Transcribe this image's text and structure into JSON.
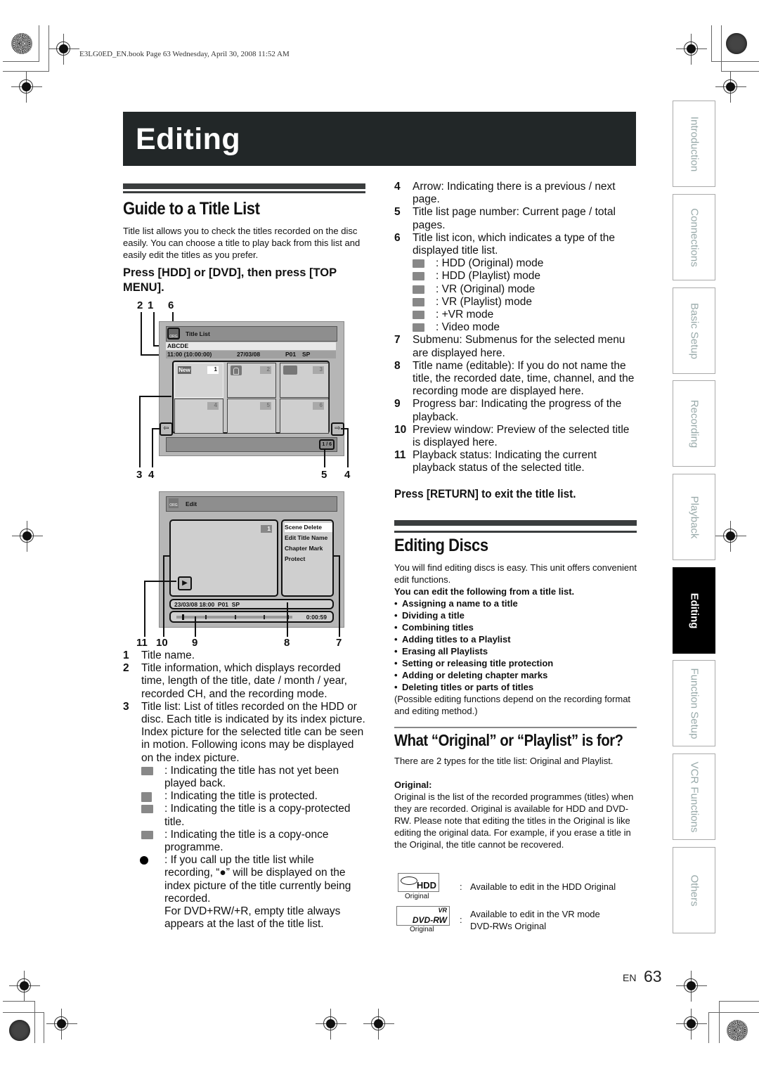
{
  "print_header": "E3LG0ED_EN.book  Page 63  Wednesday, April 30, 2008  11:52 AM",
  "banner_title": "Editing",
  "guide": {
    "heading": "Guide to a Title List",
    "intro": "Title list allows you to check the titles recorded on the disc easily. You can choose a title to play back from this list and easily edit the titles as you prefer.",
    "step": "Press [HDD] or [DVD], then press [TOP MENU]."
  },
  "title_list_screen": {
    "callouts_top": [
      "2",
      "1",
      "6"
    ],
    "icon_label": "ORG",
    "title": "Title List",
    "selected_name": "ABCDE",
    "info_time": "11:00 (10:00:00)",
    "info_date": "27/03/08",
    "info_ch": "P01",
    "info_mode": "SP",
    "new_badge": "New",
    "cells": [
      "1",
      "2",
      "3",
      "4",
      "5",
      "6"
    ],
    "page": "1 / 6",
    "callouts_bottom": [
      "3",
      "4",
      "5",
      "4"
    ]
  },
  "edit_screen": {
    "icon_label": "ORG",
    "title": "Edit",
    "preview_number": "1",
    "submenu": [
      "Scene Delete",
      "Edit Title Name",
      "Chapter Mark",
      "Protect"
    ],
    "title_info": "23/03/08 18:00  P01  SP",
    "time": "0:00:59",
    "progress_fraction": 0.05,
    "callouts_bottom": [
      "11",
      "10",
      "9",
      "8",
      "7"
    ]
  },
  "descriptions_left": [
    {
      "num": "1",
      "text": "Title name."
    },
    {
      "num": "2",
      "text": "Title information, which displays recorded time, length of the title, date / month / year, recorded CH, and the recording mode."
    },
    {
      "num": "3",
      "text": "Title list: List of titles recorded on the HDD or disc. Each title is indicated by its index picture. Index picture for the selected title can be seen in motion. Following icons may be displayed on the index picture."
    }
  ],
  "index_icons": [
    {
      "icon": "new-icon",
      "text": ": Indicating the title has not yet been played back."
    },
    {
      "icon": "protect-lock-icon",
      "text": ": Indicating the title is protected."
    },
    {
      "icon": "copy-protected-icon",
      "text": ": Indicating the title is a copy-protected title."
    },
    {
      "icon": "copy-once-icon",
      "text": ": Indicating the title is a copy-once programme."
    },
    {
      "icon": "recording-dot-icon",
      "text": ": If you call up the title list while recording, “●” will be displayed on the index picture of the title currently being recorded."
    }
  ],
  "dvd_note": "For DVD+RW/+R, empty title always appears at the last of the title list.",
  "descriptions_right": [
    {
      "num": "4",
      "text": "Arrow: Indicating there is a previous / next page."
    },
    {
      "num": "5",
      "text": "Title list page number: Current page / total pages."
    },
    {
      "num": "6",
      "text": "Title list icon, which indicates a type of the displayed title list."
    }
  ],
  "mode_icons": [
    {
      "label": "ORG",
      "text": ": HDD (Original) mode"
    },
    {
      "label": "PL",
      "text": ": HDD (Playlist) mode"
    },
    {
      "label": "ORG",
      "text": ": VR (Original) mode"
    },
    {
      "label": "PL",
      "text": ": VR (Playlist) mode"
    },
    {
      "label": "+VR",
      "text": ": +VR mode"
    },
    {
      "label": "Video",
      "text": ": Video mode"
    }
  ],
  "descriptions_right_2": [
    {
      "num": "7",
      "text": "Submenu: Submenus for the selected menu are displayed here."
    },
    {
      "num": "8",
      "text": "Title name (editable): If you do not name the title, the recorded date, time, channel, and the recording mode are displayed here."
    },
    {
      "num": "9",
      "text": "Progress bar: Indicating the progress of the playback."
    },
    {
      "num": "10",
      "text": "Preview window: Preview of the selected title is displayed here."
    },
    {
      "num": "11",
      "text": "Playback status: Indicating the current playback status of the selected title."
    }
  ],
  "return_step": "Press [RETURN] to exit the title list.",
  "editing_discs": {
    "heading": "Editing Discs",
    "intro": "You will find editing discs is easy. This unit offers convenient edit functions.",
    "lead": "You can edit the following from a title list.",
    "items": [
      "Assigning a name to a title",
      "Dividing a title",
      "Combining titles",
      "Adding titles to a Playlist",
      "Erasing all Playlists",
      "Setting or releasing title protection",
      "Adding or deleting chapter marks",
      "Deleting titles or parts of titles"
    ],
    "note": "(Possible editing functions depend on the recording format and editing method.)"
  },
  "original_playlist": {
    "heading": "What “Original” or “Playlist” is for?",
    "intro": "There are 2 types for the title list: Original and Playlist.",
    "original_label": "Original:",
    "original_text": "Original is the list of the recorded programmes (titles) when they are recorded. Original is available for HDD and DVD-RW. Please note that editing the titles in the Original is like editing the original data. For example, if you erase a title in the Original, the title cannot be recovered.",
    "logos": [
      {
        "logo_text": "HDD",
        "caption": "Original",
        "sep": ":",
        "text": "Available to edit in the HDD Original"
      },
      {
        "logo_text": "DVD-RW",
        "logo_sup": "VR",
        "caption": "Original",
        "sep": ":",
        "text": "Available to edit in the VR mode DVD-RWs Original"
      }
    ]
  },
  "side_tabs": [
    {
      "label": "Introduction",
      "active": false
    },
    {
      "label": "Connections",
      "active": false
    },
    {
      "label": "Basic Setup",
      "active": false
    },
    {
      "label": "Recording",
      "active": false
    },
    {
      "label": "Playback",
      "active": false
    },
    {
      "label": "Editing",
      "active": true
    },
    {
      "label": "Function Setup",
      "active": false
    },
    {
      "label": "VCR Functions",
      "active": false
    },
    {
      "label": "Others",
      "active": false
    }
  ],
  "footer": {
    "lang": "EN",
    "page": "63"
  }
}
